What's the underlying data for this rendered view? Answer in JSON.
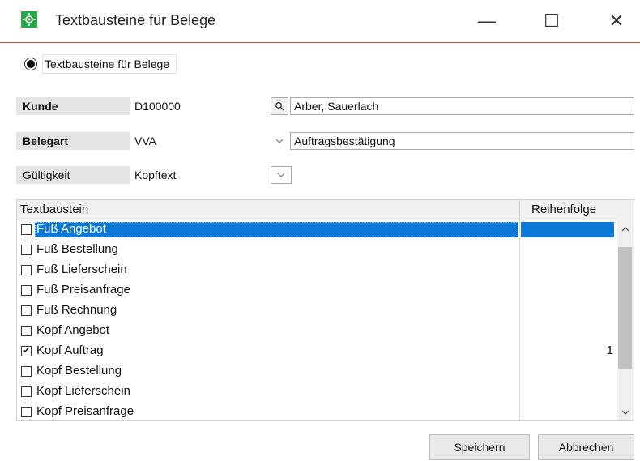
{
  "window": {
    "title": "Textbausteine für Belege",
    "controls": {
      "minimize": "—",
      "maximize": "☐",
      "close": "✕"
    }
  },
  "radio": {
    "label": "Textbausteine für Belege",
    "selected": true
  },
  "fields": {
    "kunde": {
      "label": "Kunde",
      "value": "D100000",
      "description": "Arber, Sauerlach"
    },
    "belegart": {
      "label": "Belegart",
      "value": "VVA",
      "description": "Auftragsbestätigung"
    },
    "gueltigkeit": {
      "label": "Gültigkeit",
      "value": "Kopftext"
    }
  },
  "table": {
    "columns": [
      "Textbaustein",
      "Reihenfolge"
    ],
    "rows": [
      {
        "label": "Fuß Angebot",
        "checked": false,
        "order": "",
        "selected": true
      },
      {
        "label": "Fuß Bestellung",
        "checked": false,
        "order": ""
      },
      {
        "label": "Fuß Lieferschein",
        "checked": false,
        "order": ""
      },
      {
        "label": "Fuß Preisanfrage",
        "checked": false,
        "order": ""
      },
      {
        "label": "Fuß Rechnung",
        "checked": false,
        "order": ""
      },
      {
        "label": "Kopf Angebot",
        "checked": false,
        "order": ""
      },
      {
        "label": "Kopf Auftrag",
        "checked": true,
        "order": "1"
      },
      {
        "label": "Kopf Bestellung",
        "checked": false,
        "order": ""
      },
      {
        "label": "Kopf Lieferschein",
        "checked": false,
        "order": ""
      },
      {
        "label": "Kopf Preisanfrage",
        "checked": false,
        "order": ""
      }
    ]
  },
  "buttons": {
    "save": "Speichern",
    "cancel": "Abbrechen"
  },
  "colors": {
    "selection": "#0a78d4",
    "accent_line": "#c9514b",
    "app_icon": "#2aa44a"
  }
}
